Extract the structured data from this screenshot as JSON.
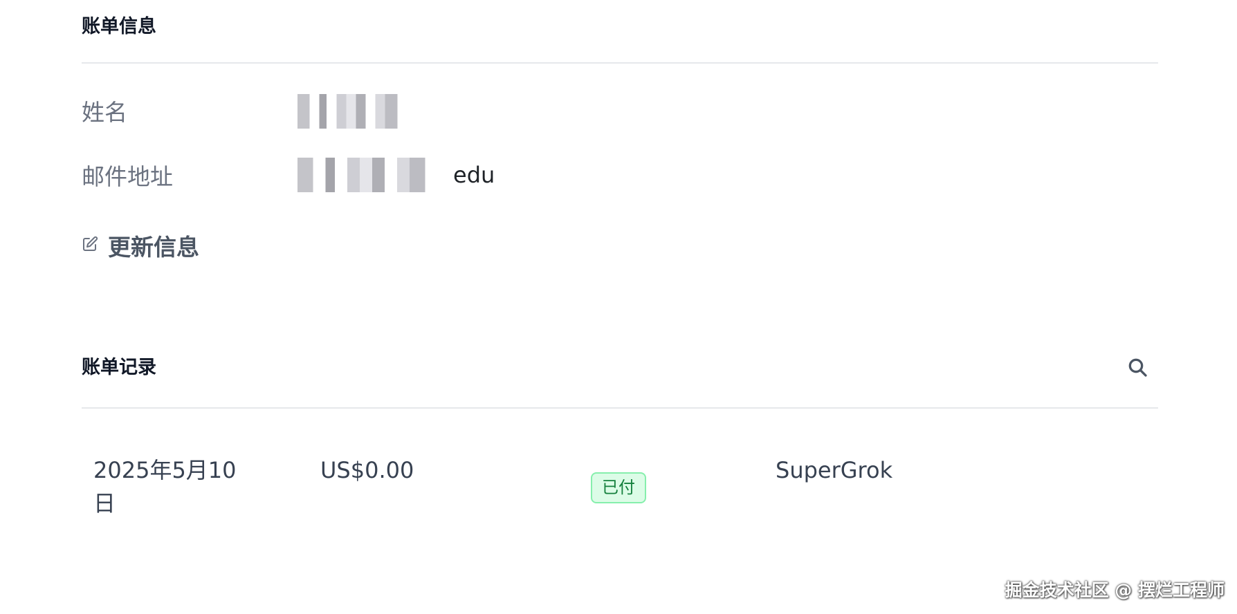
{
  "billing_info": {
    "title": "账单信息",
    "name_label": "姓名",
    "email_label": "邮件地址",
    "email_suffix": "edu",
    "update_label": "更新信息"
  },
  "billing_records": {
    "title": "账单记录",
    "rows": [
      {
        "date": "2025年5月10日",
        "amount": "US$0.00",
        "status": "已付",
        "product": "SuperGrok"
      }
    ]
  },
  "watermark": "掘金技术社区 @ 摆烂工程师",
  "colors": {
    "status_paid_bg": "#dcfce7",
    "status_paid_text": "#15803d"
  }
}
